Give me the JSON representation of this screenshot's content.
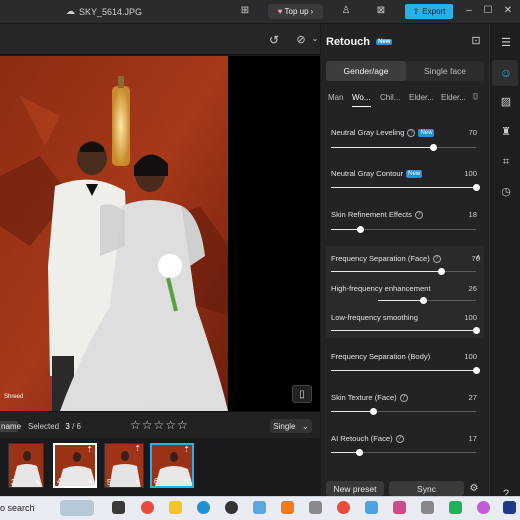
{
  "titlebar": {
    "filename": "SKY_5614.JPG",
    "topup_label": "Top up",
    "export_label": "Export"
  },
  "panel": {
    "title": "Retouch",
    "title_badge": "New",
    "seg_tabs": [
      "Gender/age",
      "Single face"
    ],
    "person_tabs": [
      "Man",
      "Wo...",
      "Chil...",
      "Elder...",
      "Elder..."
    ],
    "new_badge": "New",
    "sliders": [
      {
        "label": "Neutral Gray Leveling",
        "value": "70",
        "badge": true
      },
      {
        "label": "Neutral Gray Contour",
        "value": "100",
        "badge": true
      },
      {
        "label": "Skin Refinement Effects",
        "value": "18",
        "badge": false
      },
      {
        "label": "Frequency Separation (Face)",
        "value": "76",
        "badge": false
      },
      {
        "label": "High-frequency enhancement",
        "value": "26",
        "badge": false
      },
      {
        "label": "Low-frequency smoothing",
        "value": "100",
        "badge": false
      },
      {
        "label": "Frequency Separation (Body)",
        "value": "100",
        "badge": false
      },
      {
        "label": "Skin Texture (Face)",
        "value": "27",
        "badge": false
      },
      {
        "label": "AI Retouch (Face)",
        "value": "17",
        "badge": false
      }
    ],
    "new_preset_label": "New preset",
    "sync_label": "Sync"
  },
  "filmbar": {
    "name_label": "name",
    "selected_label": "Selected",
    "selected_count": "3",
    "total_count": "/ 6",
    "stars": "☆☆☆☆☆",
    "view_mode": "Single"
  },
  "thumbnails": [
    {
      "num": "3"
    },
    {
      "num": "4"
    },
    {
      "num": "5"
    },
    {
      "num": "6"
    }
  ],
  "photo": {
    "watermark": "Shreed"
  },
  "taskbar": {
    "search_text": "o search"
  },
  "icons": {
    "cloud": "cloud-icon",
    "gift": "gift-icon",
    "user": "user-icon"
  }
}
